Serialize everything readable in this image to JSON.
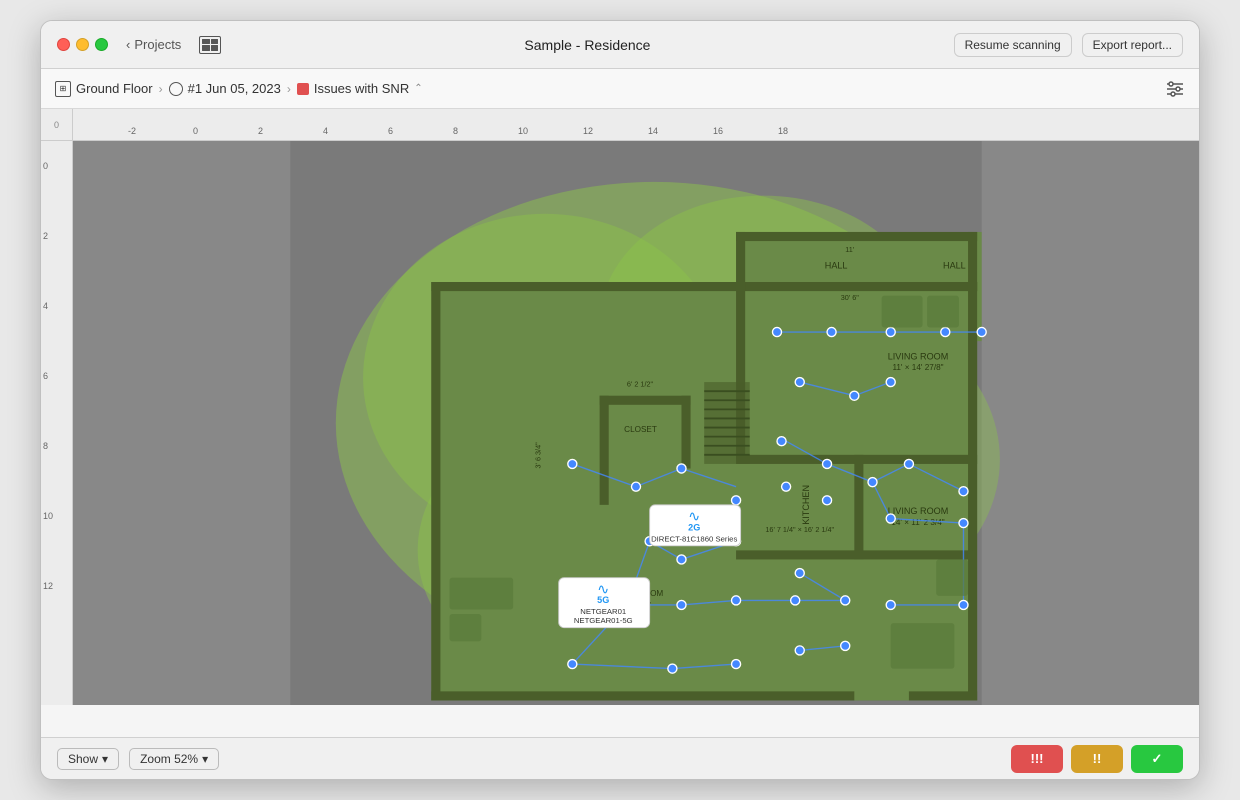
{
  "window": {
    "title": "Sample - Residence"
  },
  "titlebar": {
    "back_label": "Projects",
    "resume_btn": "Resume scanning",
    "export_btn": "Export report..."
  },
  "toolbar": {
    "floor_label": "Ground Floor",
    "scan_label": "#1 Jun 05, 2023",
    "issues_label": "Issues with SNR"
  },
  "bottombar": {
    "show_label": "Show",
    "zoom_label": "Zoom 52%"
  },
  "status_indicators": {
    "red": "!!!",
    "yellow": "!!",
    "green": "✓"
  },
  "access_points": [
    {
      "id": "ap1",
      "band": "2G",
      "name": "DIRECT-81C1860 Series",
      "x": 31,
      "y": 49
    },
    {
      "id": "ap2",
      "band": "5G",
      "name": "NETGEAR01\nNETGEAR01-5G",
      "x": 28,
      "y": 60
    }
  ],
  "ruler": {
    "h_ticks": [
      "-2",
      "0",
      "2",
      "4",
      "6",
      "8",
      "10",
      "12",
      "14",
      "16",
      "18"
    ],
    "v_ticks": [
      "0",
      "2",
      "4",
      "6",
      "8",
      "10",
      "12"
    ]
  }
}
